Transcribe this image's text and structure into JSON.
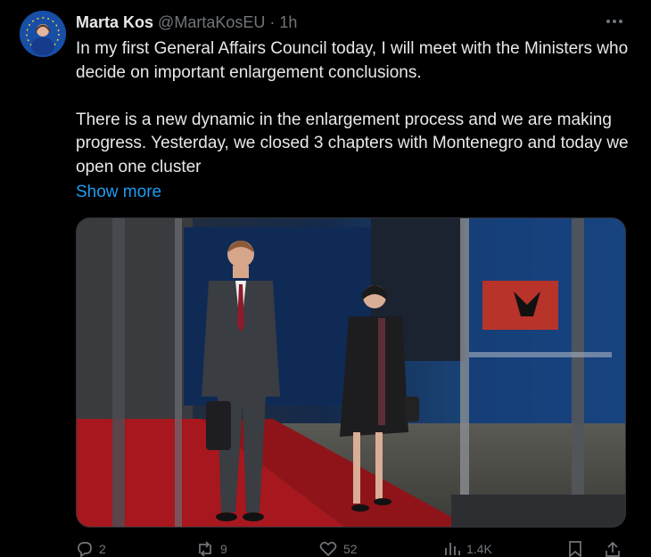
{
  "author": {
    "display_name": "Marta Kos",
    "handle": "@MartaKosEU",
    "separator": "·",
    "time": "1h"
  },
  "tweet": {
    "paragraph1": "In my first General Affairs Council today, I will meet with the Ministers who decide on important enlargement conclusions.",
    "paragraph2": "There is a new dynamic in the enlargement process and we are making progress. Yesterday, we closed 3 chapters with Montenegro and today we open one cluster",
    "show_more": "Show more"
  },
  "actions": {
    "replies": "2",
    "reposts": "9",
    "likes": "52",
    "views": "1.4K"
  },
  "icons": {
    "more": "more-options-icon",
    "reply": "reply-icon",
    "repost": "repost-icon",
    "like": "heart-icon",
    "views": "views-icon",
    "bookmark": "bookmark-icon",
    "share": "share-icon"
  },
  "colors": {
    "background": "#000000",
    "text": "#e7e9ea",
    "muted": "#71767b",
    "link": "#1d9bf0"
  }
}
